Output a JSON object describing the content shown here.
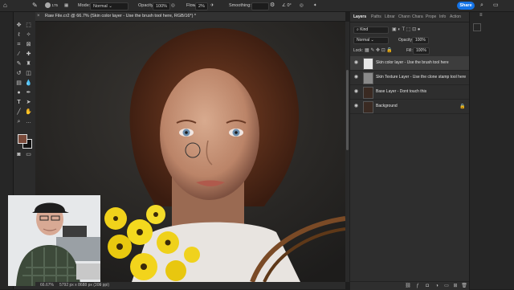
{
  "options_bar": {
    "brush_size": "175",
    "mode_label": "Mode:",
    "mode_value": "Normal",
    "opacity_label": "Opacity:",
    "opacity_value": "100%",
    "flow_label": "Flow:",
    "flow_value": "2%",
    "smoothing_label": "Smoothing:",
    "share_label": "Share"
  },
  "document": {
    "tab_title": "Raw File.cr2 @ 66.7% (Skin color layer - Use the brush tool here, RGB/16*) *",
    "zoom": "66.67%",
    "doc_info": "5792 px x 8688 px (300 ppi)"
  },
  "panel": {
    "tabs": [
      "Layers",
      "Paths",
      "Librar",
      "Chann",
      "Chara",
      "Prope",
      "Info",
      "Action"
    ],
    "kind_label": "Kind",
    "blend_mode": "Normal",
    "opacity_label": "Opacity:",
    "opacity_value": "100%",
    "lock_label": "Lock:",
    "fill_label": "Fill:",
    "fill_value": "100%",
    "layers": [
      {
        "name": "Skin color layer - Use the brush tool here",
        "selected": true
      },
      {
        "name": "Skin Texture Layer - Use the clone stamp tool here",
        "selected": false
      },
      {
        "name": "Base Layer - Dont touch this",
        "selected": false
      },
      {
        "name": "Background",
        "selected": false
      }
    ]
  },
  "colors": {
    "foreground": "#7a4a3a",
    "background": "#111111",
    "accent": "#1473e6"
  }
}
